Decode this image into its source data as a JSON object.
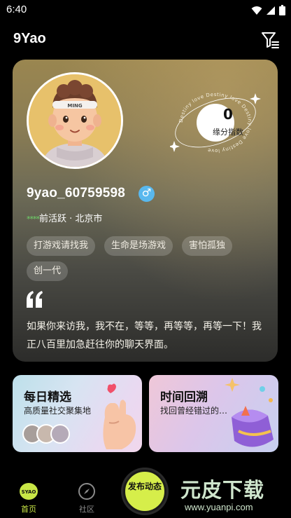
{
  "status_bar": {
    "time": "6:40",
    "icons": [
      "wifi-icon",
      "signal-icon",
      "battery-icon"
    ]
  },
  "header": {
    "title": "9Yao",
    "filter_icon": "filter-icon"
  },
  "profile": {
    "name": "9yao_60759598",
    "gender_symbol": "♂",
    "activity_stars": "****",
    "activity": "前活跃 · 北京市",
    "destiny_value": "0",
    "destiny_label": "缘分指数",
    "destiny_ring_text": "Destiny love Destiny love Destiny love Destiny love",
    "avatar_badge": "MING",
    "tags": [
      "打游戏请找我",
      "生命是场游戏",
      "害怕孤独",
      "创一代"
    ],
    "bio": "如果你来访我，我不在，等等，再等等，再等一下！我正八百里加急赶往你的聊天界面。"
  },
  "cards": {
    "daily": {
      "title": "每日精选",
      "subtitle": "高质量社交聚集地"
    },
    "time": {
      "title": "时间回溯",
      "subtitle": "找回曾经错过的…"
    }
  },
  "nav": {
    "home_label": "首页",
    "home_logo": "SYAO",
    "community_label": "社区",
    "publish_label": "发布动态"
  },
  "watermark": {
    "text": "元皮下载",
    "url": "www.yuanpi.com"
  },
  "colors": {
    "accent_publish": "#d6ee4a",
    "gender_badge": "#59b8ee",
    "active_green": "#6fd66a",
    "nav_active": "#c8e646"
  }
}
